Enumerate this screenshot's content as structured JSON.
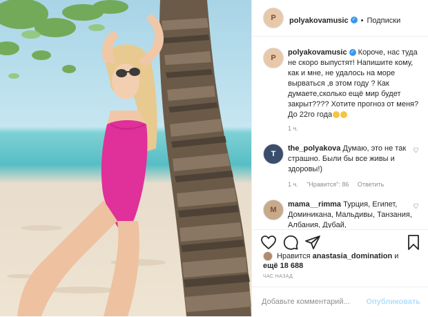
{
  "header": {
    "username": "polyakovamusic",
    "avatar_initials": "P",
    "verified_icon": "verified-badge-icon",
    "separator": "•",
    "follow_label": "Подписки"
  },
  "caption": {
    "username": "polyakovamusic",
    "text": "Короче, нас туда не скоро выпустят! Напишите кому, как и мне, не удалось на море вырваться ,в этом году ? Как думаете,сколько ещё мир будет закрыт???? Хотите прогноз от меня? До 22го года",
    "emoji_count": 2,
    "time": "1 ч."
  },
  "comments": [
    {
      "username": "the_polyakova",
      "text": "Думаю, это не так страшно. Были бы все живы и здоровы!)",
      "time": "1 ч.",
      "likes": "\"Нравится\": 86",
      "reply": "Ответить",
      "avatar_initials": "T"
    },
    {
      "username": "mama__rimma",
      "text": "Турция, Египет, Доминикана, Мальдивы, Танзания, Албания, Дубай,",
      "avatar_initials": "M"
    }
  ],
  "likes": {
    "prefix": "Нравится",
    "user": "anastasia_domination",
    "conj": "и",
    "more": "ещё 18 688"
  },
  "timestamp": "ЧАС НАЗАД",
  "comment_input": {
    "placeholder": "Добавьте комментарий...",
    "publish_label": "Опубликовать"
  },
  "colors": {
    "accent": "#3897f0",
    "publish_disabled": "#b2dffc",
    "swimsuit": "#e0309a"
  }
}
